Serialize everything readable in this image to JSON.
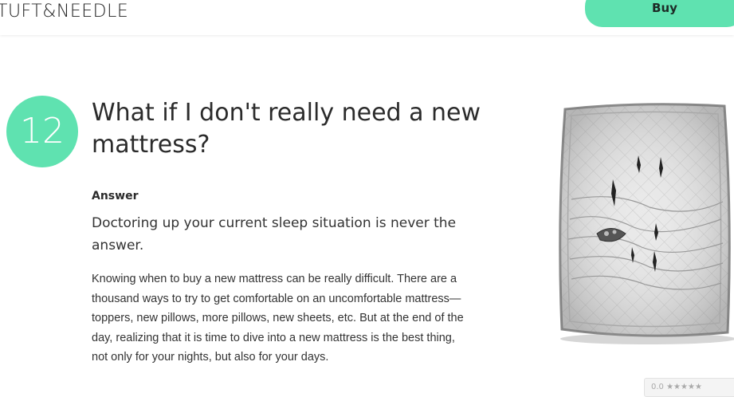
{
  "header": {
    "logo": "TUFT&NEEDLE",
    "buy_label": "Buy"
  },
  "faq": {
    "number": "12",
    "question": "What if I don't really need a new mattress?",
    "answer_label": "Answer",
    "lead": "Doctoring up your current sleep situation is never the answer.",
    "body": "Knowing when to buy a new mattress can be really difficult. There are a thousand ways to try to get comfortable on an uncomfortable mattress—toppers, new pillows, more pillows, new sheets, etc. But at the end of the day, realizing that it is time to dive into a new mattress is the best thing, not only for your nights, but also for your days."
  },
  "rating_widget": {
    "text": "0.0 ★★★★★"
  },
  "colors": {
    "accent": "#5fe2b0"
  }
}
